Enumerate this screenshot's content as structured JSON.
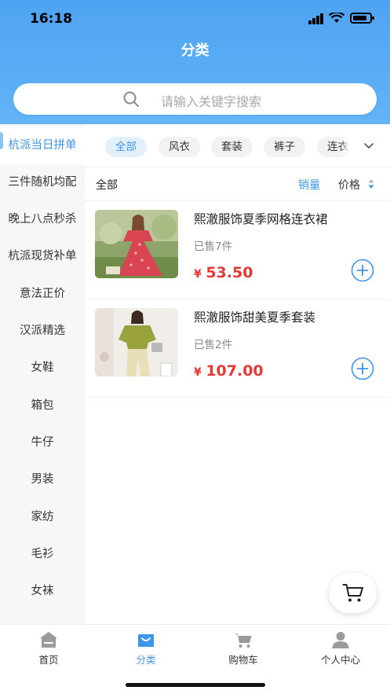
{
  "status_bar": {
    "time": "16:18"
  },
  "header": {
    "title": "分类"
  },
  "search": {
    "placeholder": "请输入关键字搜索"
  },
  "sidebar": {
    "items": [
      {
        "label": "杭派当日拼单",
        "active": true
      },
      {
        "label": "三件随机均配"
      },
      {
        "label": "晚上八点秒杀"
      },
      {
        "label": "杭派现货补单"
      },
      {
        "label": "意法正价"
      },
      {
        "label": "汉派精选"
      },
      {
        "label": "女鞋"
      },
      {
        "label": "箱包"
      },
      {
        "label": "牛仔"
      },
      {
        "label": "男装"
      },
      {
        "label": "家纺"
      },
      {
        "label": "毛衫"
      },
      {
        "label": "女袜"
      }
    ]
  },
  "tabs": [
    {
      "label": "全部",
      "active": true
    },
    {
      "label": "风衣"
    },
    {
      "label": "套装"
    },
    {
      "label": "裤子"
    },
    {
      "label": "连衣"
    }
  ],
  "sort": {
    "all_label": "全部",
    "sales_label": "销量",
    "price_label": "价格"
  },
  "products": [
    {
      "name": "熙澈服饰夏季网格连衣裙",
      "sold": "已售7件",
      "currency": "¥",
      "price": "53.50"
    },
    {
      "name": "熙澈服饰甜美夏季套装",
      "sold": "已售2件",
      "currency": "¥",
      "price": "107.00"
    }
  ],
  "tabbar": {
    "items": [
      {
        "label": "首页",
        "icon": "home-icon"
      },
      {
        "label": "分类",
        "icon": "category-icon",
        "active": true
      },
      {
        "label": "购物车",
        "icon": "cart-icon"
      },
      {
        "label": "个人中心",
        "icon": "user-icon"
      }
    ]
  },
  "colors": {
    "accent": "#3c95ea",
    "header": "#4ea3f2",
    "price": "#e53935"
  }
}
